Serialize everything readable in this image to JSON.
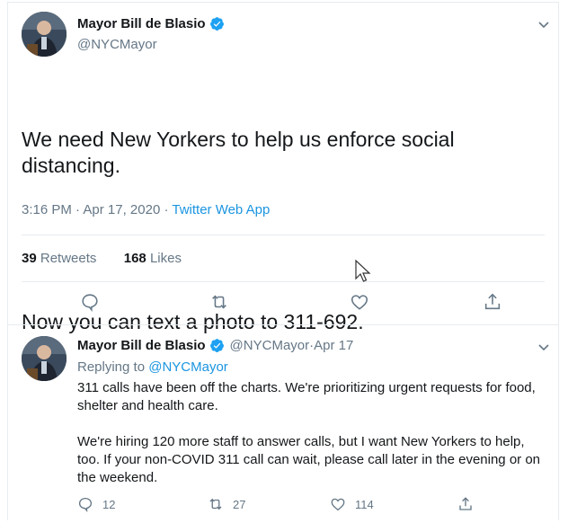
{
  "tweet": {
    "author_name": "Mayor Bill de Blasio",
    "author_handle": "@NYCMayor",
    "paragraph1": "We need New Yorkers to help us enforce social distancing.",
    "paragraph2": "Now you can text a photo to 311-692.",
    "time": "3:16 PM",
    "date": "Apr 17, 2020",
    "meta_sep1": " · ",
    "meta_sep2": " · ",
    "source": "Twitter Web App",
    "retweets_count": "39",
    "retweets_label": "Retweets",
    "likes_count": "168",
    "likes_label": "Likes",
    "actions": [
      "reply-icon",
      "retweet-icon",
      "like-icon",
      "share-icon"
    ]
  },
  "reply": {
    "author_name": "Mayor Bill de Blasio",
    "author_handle": "@NYCMayor",
    "dot": " · ",
    "date": "Apr 17",
    "replying_prefix": "Replying to",
    "replying_to": "@NYCMayor",
    "paragraph1": "311 calls have been off the charts. We're prioritizing urgent requests for food, shelter and health care.",
    "paragraph2": "We're hiring 120 more staff to answer calls, but I want New Yorkers to help, too. If your non-COVID 311 call can wait, please call later in the evening or on the weekend.",
    "reply_count": "12",
    "retweet_count": "27",
    "like_count": "114"
  },
  "colors": {
    "accent": "#1b95e0",
    "muted": "#657786",
    "text": "#14171a",
    "divider": "#e6ecf0"
  }
}
